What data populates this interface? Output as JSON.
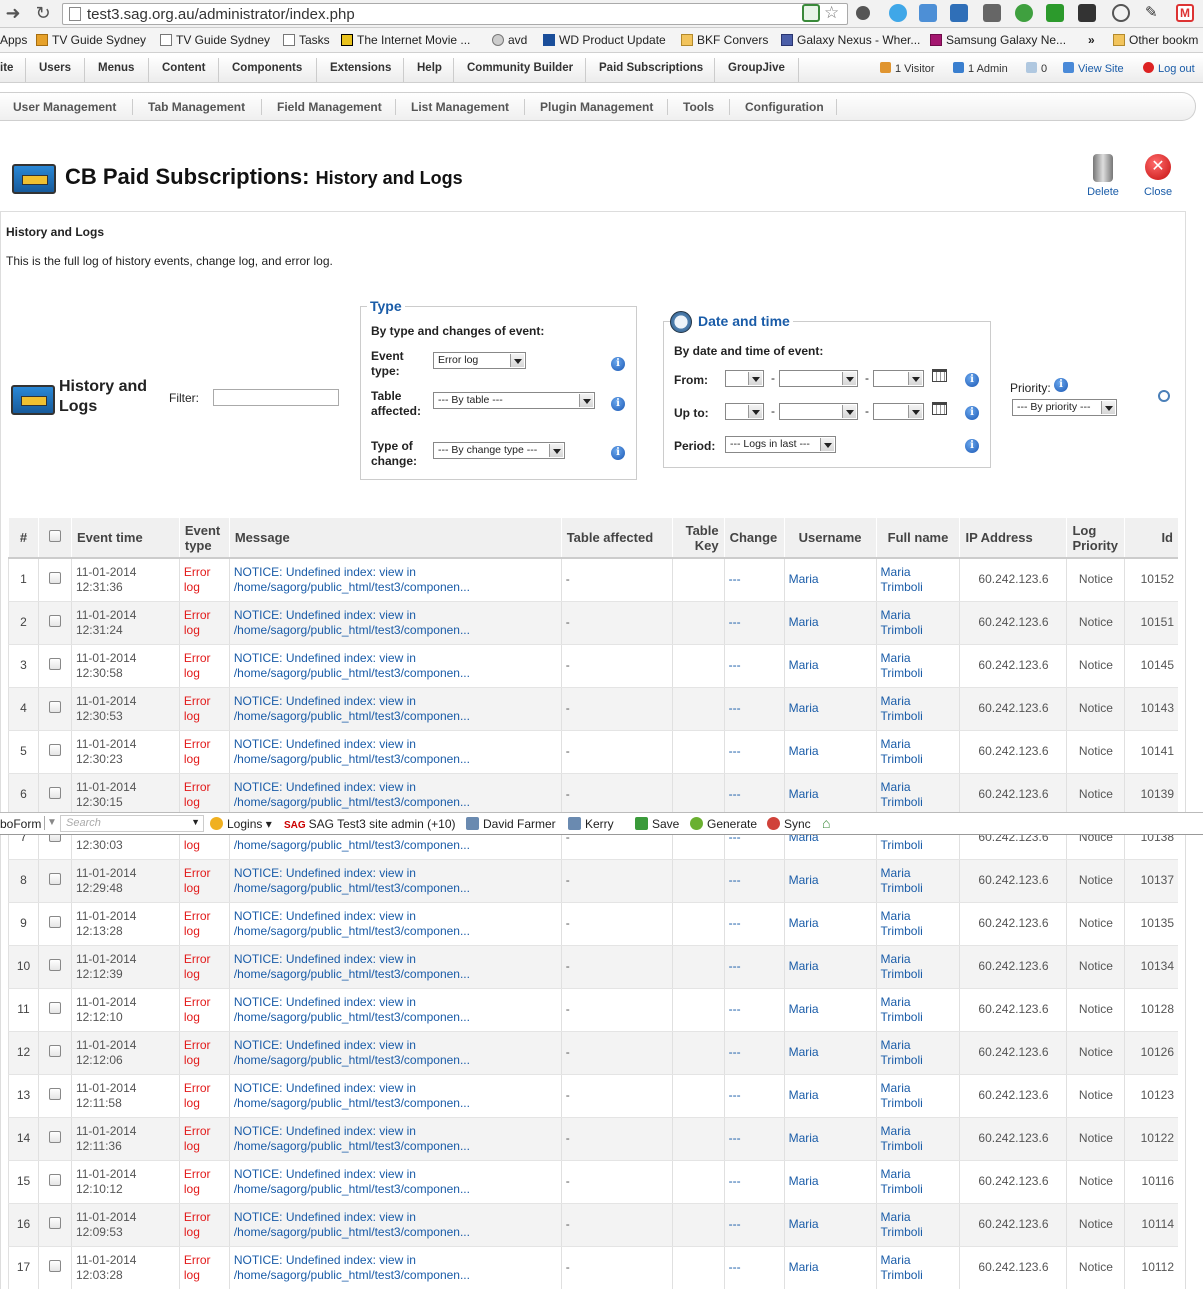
{
  "browser": {
    "url": "test3.sag.org.au/administrator/index.php"
  },
  "bookmarks": [
    "Apps",
    "TV Guide Sydney",
    "TV Guide Sydney",
    "Tasks",
    "The Internet Movie ...",
    "avd",
    "WD Product Update",
    "BKF Convers",
    "Galaxy Nexus - Wher...",
    "Samsung Galaxy Ne...",
    "»",
    "Other bookm"
  ],
  "admin_menu": {
    "items": [
      "ite",
      "Users",
      "Menus",
      "Content",
      "Components",
      "Extensions",
      "Help",
      "Community Builder",
      "Paid Subscriptions",
      "GroupJive"
    ],
    "visitors": "1 Visitor",
    "admins": "1 Admin",
    "messages": "0",
    "view_site": "View Site",
    "logout": "Log out"
  },
  "submenu": [
    "User Management",
    "Tab Management",
    "Field Management",
    "List Management",
    "Plugin Management",
    "Tools",
    "Configuration"
  ],
  "title": {
    "main": "CB Paid Subscriptions:",
    "sub": "History and Logs"
  },
  "toolbar": {
    "delete": "Delete",
    "close": "Close"
  },
  "section": {
    "title": "History and Logs",
    "description": "This is the full log of history events, change log, and error log."
  },
  "filters": {
    "heading": "History and Logs",
    "filter_label": "Filter:",
    "type": {
      "legend": "Type",
      "subtitle": "By type and changes of event:",
      "event_type_label": "Event type:",
      "event_type_value": "Error log",
      "table_label": "Table affected:",
      "table_value": "--- By table ---",
      "change_label": "Type of change:",
      "change_value": "--- By change type ---"
    },
    "date": {
      "legend": "Date and time",
      "subtitle": "By date and time of event:",
      "from_label": "From:",
      "upto_label": "Up to:",
      "period_label": "Period:",
      "period_value": "--- Logs in last ---",
      "sep": "-"
    },
    "priority": {
      "label": "Priority:",
      "value": "--- By priority ---"
    }
  },
  "table": {
    "headers": [
      "#",
      "",
      "Event time",
      "Event type",
      "Message",
      "Table affected",
      "Table Key",
      "Change",
      "Username",
      "Full name",
      "IP Address",
      "Log Priority",
      "Id"
    ],
    "rows": [
      {
        "n": "1",
        "date": "11-01-2014",
        "time": "12:31:36",
        "id": "10152"
      },
      {
        "n": "2",
        "date": "11-01-2014",
        "time": "12:31:24",
        "id": "10151"
      },
      {
        "n": "3",
        "date": "11-01-2014",
        "time": "12:30:58",
        "id": "10145"
      },
      {
        "n": "4",
        "date": "11-01-2014",
        "time": "12:30:53",
        "id": "10143"
      },
      {
        "n": "5",
        "date": "11-01-2014",
        "time": "12:30:23",
        "id": "10141"
      },
      {
        "n": "6",
        "date": "11-01-2014",
        "time": "12:30:15",
        "id": "10139"
      },
      {
        "n": "7",
        "date": "11-01-2014",
        "time": "12:30:03",
        "id": "10138"
      },
      {
        "n": "8",
        "date": "11-01-2014",
        "time": "12:29:48",
        "id": "10137"
      },
      {
        "n": "9",
        "date": "11-01-2014",
        "time": "12:13:28",
        "id": "10135"
      },
      {
        "n": "10",
        "date": "11-01-2014",
        "time": "12:12:39",
        "id": "10134"
      },
      {
        "n": "11",
        "date": "11-01-2014",
        "time": "12:12:10",
        "id": "10128"
      },
      {
        "n": "12",
        "date": "11-01-2014",
        "time": "12:12:06",
        "id": "10126"
      },
      {
        "n": "13",
        "date": "11-01-2014",
        "time": "12:11:58",
        "id": "10123"
      },
      {
        "n": "14",
        "date": "11-01-2014",
        "time": "12:11:36",
        "id": "10122"
      },
      {
        "n": "15",
        "date": "11-01-2014",
        "time": "12:10:12",
        "id": "10116"
      },
      {
        "n": "16",
        "date": "11-01-2014",
        "time": "12:09:53",
        "id": "10114"
      },
      {
        "n": "17",
        "date": "11-01-2014",
        "time": "12:03:28",
        "id": "10112"
      }
    ],
    "common": {
      "type1": "Error",
      "type2": "log",
      "msg1": "NOTICE: Undefined index: view in",
      "msg2": "/home/sagorg/public_html/test3/componen...",
      "table": "-",
      "change": "---",
      "user": "Maria",
      "name1": "Maria",
      "name2": "Trimboli",
      "ip": "60.242.123.6",
      "prio": "Notice"
    }
  },
  "roboform": {
    "name": "boForm",
    "search_placeholder": "Search",
    "logins": "Logins",
    "site": "SAG Test3 site admin (+10)",
    "user1": "David Farmer",
    "user2": "Kerry",
    "save": "Save",
    "generate": "Generate",
    "sync": "Sync"
  }
}
